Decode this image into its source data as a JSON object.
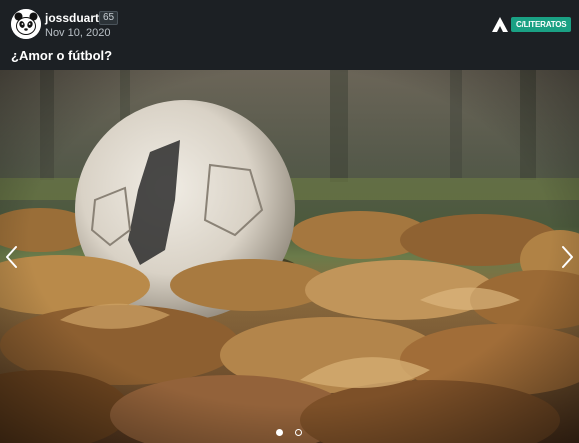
{
  "post": {
    "author": "jossduarte",
    "reputation": "65",
    "date": "Nov 10, 2020",
    "community": "C/LITERATOS",
    "title": "¿Amor o fútbol?"
  },
  "icons": {
    "avatar": "panda-avatar",
    "community_logo": "hive-logo-icon",
    "prev": "chevron-left-icon",
    "next": "chevron-right-icon"
  },
  "gallery": {
    "image_subject": "photo",
    "slide_count": 2,
    "active_slide": 1
  },
  "colors": {
    "header_bg": "#1c2024",
    "badge_bg": "#1aa184",
    "text": "#ffffff"
  }
}
